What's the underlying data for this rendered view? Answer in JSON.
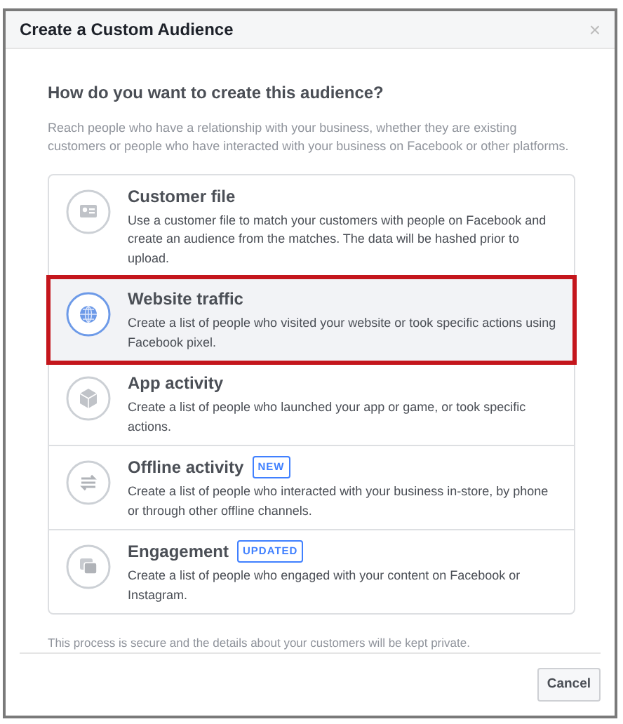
{
  "dialog": {
    "title": "Create a Custom Audience",
    "close": "×"
  },
  "heading": "How do you want to create this audience?",
  "intro": "Reach people who have a relationship with your business, whether they are existing customers or people who have interacted with your business on Facebook or other platforms.",
  "options": [
    {
      "kind": "customer-file",
      "title": "Customer file",
      "description": "Use a customer file to match your customers with people on Facebook and create an audience from the matches. The data will be hashed prior to upload.",
      "selected": false
    },
    {
      "kind": "website",
      "title": "Website traffic",
      "description": "Create a list of people who visited your website or took specific actions using Facebook pixel.",
      "selected": true
    },
    {
      "kind": "app",
      "title": "App activity",
      "description": "Create a list of people who launched your app or game, or took specific actions.",
      "selected": false
    },
    {
      "kind": "offline",
      "title": "Offline activity",
      "badge": "NEW",
      "description": "Create a list of people who interacted with your business in-store, by phone or through other offline channels.",
      "selected": false
    },
    {
      "kind": "engagement",
      "title": "Engagement",
      "badge": "UPDATED",
      "description": "Create a list of people who engaged with your content on Facebook or Instagram.",
      "selected": false
    }
  ],
  "footnote": "This process is secure and the details about your customers will be kept private.",
  "buttons": [
    "Cancel"
  ]
}
